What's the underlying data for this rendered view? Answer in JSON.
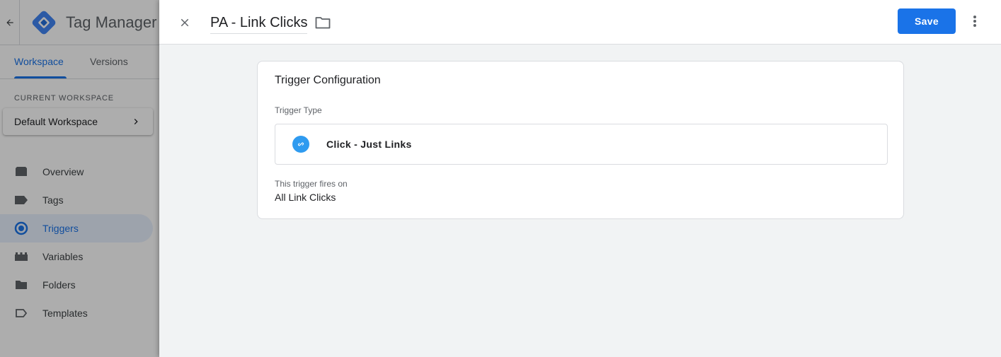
{
  "app": {
    "title": "Tag Manager",
    "tabs": [
      {
        "label": "Workspace",
        "active": true
      },
      {
        "label": "Versions",
        "active": false
      }
    ]
  },
  "sidebar": {
    "workspace_label": "CURRENT WORKSPACE",
    "workspace_name": "Default Workspace",
    "items": [
      {
        "label": "Overview",
        "icon": "overview-icon",
        "active": false
      },
      {
        "label": "Tags",
        "icon": "tag-icon",
        "active": false
      },
      {
        "label": "Triggers",
        "icon": "trigger-icon",
        "active": true
      },
      {
        "label": "Variables",
        "icon": "variables-icon",
        "active": false
      },
      {
        "label": "Folders",
        "icon": "folder-icon",
        "active": false
      },
      {
        "label": "Templates",
        "icon": "template-icon",
        "active": false
      }
    ]
  },
  "editor": {
    "trigger_name": "PA - Link Clicks",
    "save_label": "Save",
    "config": {
      "title": "Trigger Configuration",
      "type_label": "Trigger Type",
      "type_value": "Click - Just Links",
      "fires_label": "This trigger fires on",
      "fires_value": "All Link Clicks"
    }
  },
  "colors": {
    "accent": "#1a73e8",
    "trigger_icon_bg": "#2f9bf0",
    "active_nav_bg": "#e8f0fe"
  }
}
